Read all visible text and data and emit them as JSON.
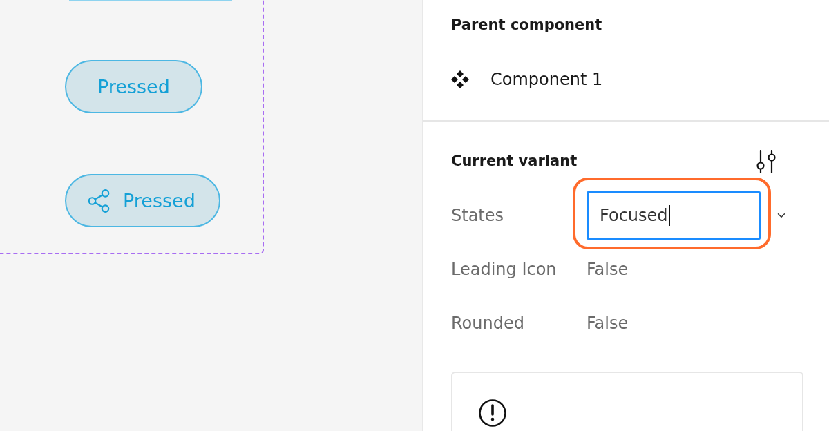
{
  "canvas": {
    "buttons": [
      {
        "kind": "plain",
        "label": "Pressed"
      },
      {
        "kind": "icon",
        "label": "Pressed"
      }
    ]
  },
  "panel": {
    "parent_component": {
      "title": "Parent component",
      "name": "Component 1"
    },
    "current_variant": {
      "title": "Current variant",
      "properties": [
        {
          "kind": "dropdown",
          "label": "States",
          "value": "Focused",
          "focused": true
        },
        {
          "kind": "text",
          "label": "Leading Icon",
          "value": "False"
        },
        {
          "kind": "text",
          "label": "Rounded",
          "value": "False"
        }
      ]
    }
  }
}
